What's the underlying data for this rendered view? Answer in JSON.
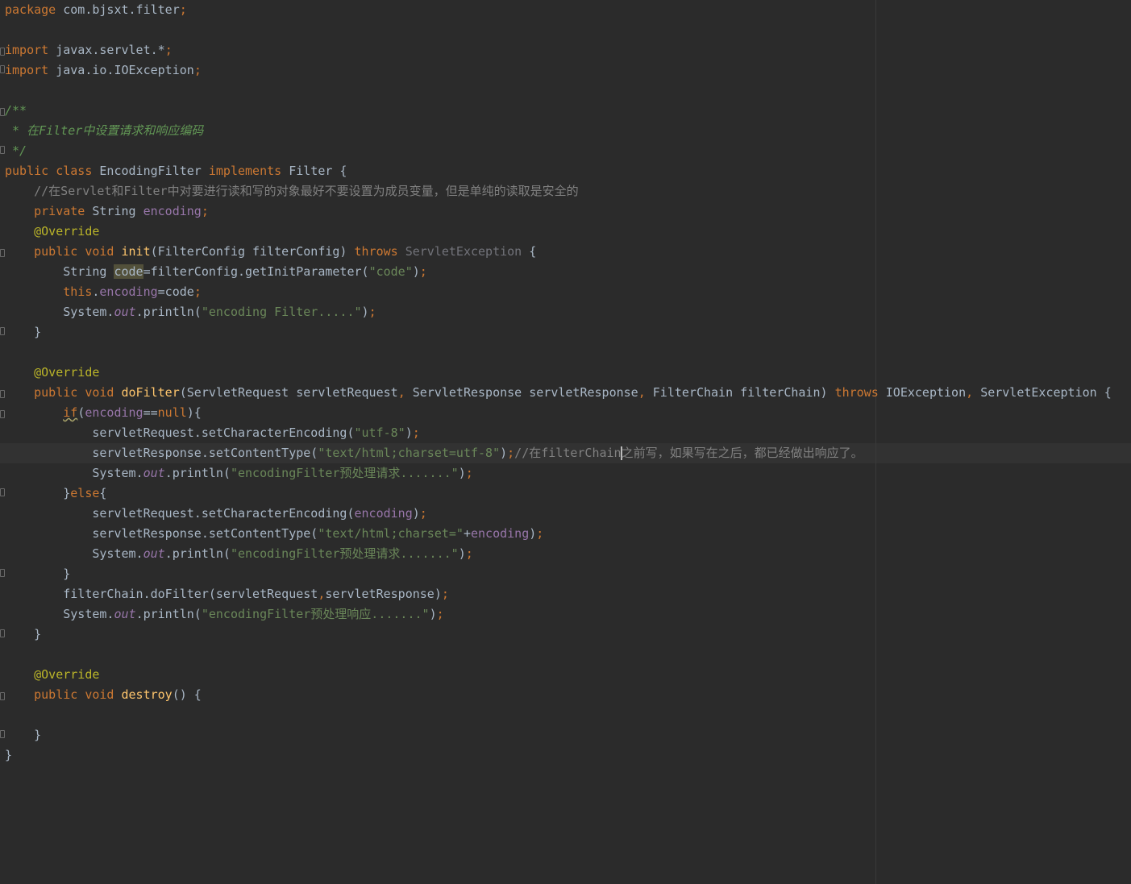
{
  "editor": {
    "language": "java",
    "current_line": 23,
    "highlighted_identifier": "code",
    "lines": [
      {
        "tokens": [
          {
            "t": "package ",
            "c": "kw"
          },
          {
            "t": "com.bjsxt.filter",
            "c": "plain"
          },
          {
            "t": ";",
            "c": "kw"
          }
        ]
      },
      {
        "tokens": []
      },
      {
        "fold": "start",
        "tokens": [
          {
            "t": "import ",
            "c": "kw"
          },
          {
            "t": "javax.servlet.*",
            "c": "plain"
          },
          {
            "t": ";",
            "c": "kw"
          }
        ]
      },
      {
        "fold": "end",
        "tokens": [
          {
            "t": "import ",
            "c": "kw"
          },
          {
            "t": "java.io.IOException",
            "c": "plain"
          },
          {
            "t": ";",
            "c": "kw"
          }
        ]
      },
      {
        "tokens": []
      },
      {
        "fold": "start",
        "tokens": [
          {
            "t": "/**",
            "c": "doc"
          }
        ]
      },
      {
        "tokens": [
          {
            "t": " * 在Filter中设置请求和响应编码",
            "c": "doc"
          }
        ]
      },
      {
        "fold": "end",
        "tokens": [
          {
            "t": " */",
            "c": "doc"
          }
        ]
      },
      {
        "tokens": [
          {
            "t": "public class ",
            "c": "kw"
          },
          {
            "t": "EncodingFilter ",
            "c": "plain"
          },
          {
            "t": "implements ",
            "c": "kw"
          },
          {
            "t": "Filter {",
            "c": "plain"
          }
        ]
      },
      {
        "tokens": [
          {
            "t": "    //在Servlet和Filter中对要进行读和写的对象最好不要设置为成员变量，但是单纯的读取是安全的",
            "c": "cmt"
          }
        ]
      },
      {
        "tokens": [
          {
            "t": "    private ",
            "c": "kw"
          },
          {
            "t": "String ",
            "c": "plain"
          },
          {
            "t": "encoding",
            "c": "field"
          },
          {
            "t": ";",
            "c": "kw"
          }
        ]
      },
      {
        "tokens": [
          {
            "t": "    @Override",
            "c": "ann"
          }
        ]
      },
      {
        "fold": "start",
        "tokens": [
          {
            "t": "    public void ",
            "c": "kw"
          },
          {
            "t": "init",
            "c": "method"
          },
          {
            "t": "(FilterConfig filterConfig) ",
            "c": "plain"
          },
          {
            "t": "throws ",
            "c": "kw"
          },
          {
            "t": "ServletException",
            "c": "unused"
          },
          {
            "t": " {",
            "c": "plain"
          }
        ]
      },
      {
        "tokens": [
          {
            "t": "        String ",
            "c": "plain"
          },
          {
            "t": "code",
            "c": "hl"
          },
          {
            "t": "=filterConfig.getInitParameter(",
            "c": "plain"
          },
          {
            "t": "\"code\"",
            "c": "str"
          },
          {
            "t": ")",
            "c": "plain"
          },
          {
            "t": ";",
            "c": "kw"
          }
        ]
      },
      {
        "tokens": [
          {
            "t": "        this",
            "c": "kw"
          },
          {
            "t": ".",
            "c": "plain"
          },
          {
            "t": "encoding",
            "c": "field"
          },
          {
            "t": "=code",
            "c": "plain"
          },
          {
            "t": ";",
            "c": "kw"
          }
        ]
      },
      {
        "tokens": [
          {
            "t": "        System.",
            "c": "plain"
          },
          {
            "t": "out",
            "c": "static"
          },
          {
            "t": ".println(",
            "c": "plain"
          },
          {
            "t": "\"encoding Filter.....\"",
            "c": "str"
          },
          {
            "t": ")",
            "c": "plain"
          },
          {
            "t": ";",
            "c": "kw"
          }
        ]
      },
      {
        "fold": "end",
        "tokens": [
          {
            "t": "    }",
            "c": "plain"
          }
        ]
      },
      {
        "tokens": []
      },
      {
        "tokens": [
          {
            "t": "    @Override",
            "c": "ann"
          }
        ]
      },
      {
        "fold": "start",
        "tokens": [
          {
            "t": "    public void ",
            "c": "kw"
          },
          {
            "t": "doFilter",
            "c": "method"
          },
          {
            "t": "(ServletRequest servletRequest",
            "c": "plain"
          },
          {
            "t": ", ",
            "c": "kw"
          },
          {
            "t": "ServletResponse servletResponse",
            "c": "plain"
          },
          {
            "t": ", ",
            "c": "kw"
          },
          {
            "t": "FilterChain filterChain) ",
            "c": "plain"
          },
          {
            "t": "throws ",
            "c": "kw"
          },
          {
            "t": "IOException",
            "c": "plain"
          },
          {
            "t": ", ",
            "c": "kw"
          },
          {
            "t": "ServletException {",
            "c": "plain"
          }
        ]
      },
      {
        "fold": "start",
        "tokens": [
          {
            "t": "        ",
            "c": "plain"
          },
          {
            "t": "if",
            "c": "kw warn"
          },
          {
            "t": "(",
            "c": "plain"
          },
          {
            "t": "encoding",
            "c": "field"
          },
          {
            "t": "==",
            "c": "plain"
          },
          {
            "t": "null",
            "c": "kw"
          },
          {
            "t": "){",
            "c": "plain"
          }
        ]
      },
      {
        "tokens": [
          {
            "t": "            servletRequest.setCharacterEncoding(",
            "c": "plain"
          },
          {
            "t": "\"utf-8\"",
            "c": "str"
          },
          {
            "t": ")",
            "c": "plain"
          },
          {
            "t": ";",
            "c": "kw"
          }
        ]
      },
      {
        "current": true,
        "tokens": [
          {
            "t": "            servletResponse.setContentType(",
            "c": "plain"
          },
          {
            "t": "\"text/html;charset=utf-8\"",
            "c": "str"
          },
          {
            "t": ")",
            "c": "plain"
          },
          {
            "t": ";",
            "c": "kw"
          },
          {
            "t": "//在filterChain",
            "c": "cmt"
          },
          {
            "t": "",
            "c": "caret"
          },
          {
            "t": "之前写，如果写在之后，都已经做出响应了。",
            "c": "cmt"
          }
        ]
      },
      {
        "tokens": [
          {
            "t": "            System.",
            "c": "plain"
          },
          {
            "t": "out",
            "c": "static"
          },
          {
            "t": ".println(",
            "c": "plain"
          },
          {
            "t": "\"encodingFilter预处理请求.......\"",
            "c": "str"
          },
          {
            "t": ")",
            "c": "plain"
          },
          {
            "t": ";",
            "c": "kw"
          }
        ]
      },
      {
        "fold": "end",
        "tokens": [
          {
            "t": "        }",
            "c": "plain"
          },
          {
            "t": "else",
            "c": "kw"
          },
          {
            "t": "{",
            "c": "plain"
          }
        ]
      },
      {
        "tokens": [
          {
            "t": "            servletRequest.setCharacterEncoding(",
            "c": "plain"
          },
          {
            "t": "encoding",
            "c": "field"
          },
          {
            "t": ")",
            "c": "plain"
          },
          {
            "t": ";",
            "c": "kw"
          }
        ]
      },
      {
        "tokens": [
          {
            "t": "            servletResponse.setContentType(",
            "c": "plain"
          },
          {
            "t": "\"text/html;charset=\"",
            "c": "str"
          },
          {
            "t": "+",
            "c": "plain"
          },
          {
            "t": "encoding",
            "c": "field"
          },
          {
            "t": ")",
            "c": "plain"
          },
          {
            "t": ";",
            "c": "kw"
          }
        ]
      },
      {
        "tokens": [
          {
            "t": "            System.",
            "c": "plain"
          },
          {
            "t": "out",
            "c": "static"
          },
          {
            "t": ".println(",
            "c": "plain"
          },
          {
            "t": "\"encodingFilter预处理请求.......\"",
            "c": "str"
          },
          {
            "t": ")",
            "c": "plain"
          },
          {
            "t": ";",
            "c": "kw"
          }
        ]
      },
      {
        "fold": "end",
        "tokens": [
          {
            "t": "        }",
            "c": "plain"
          }
        ]
      },
      {
        "tokens": [
          {
            "t": "        filterChain.doFilter(servletRequest",
            "c": "plain"
          },
          {
            "t": ",",
            "c": "kw"
          },
          {
            "t": "servletResponse)",
            "c": "plain"
          },
          {
            "t": ";",
            "c": "kw"
          }
        ]
      },
      {
        "tokens": [
          {
            "t": "        System.",
            "c": "plain"
          },
          {
            "t": "out",
            "c": "static"
          },
          {
            "t": ".println(",
            "c": "plain"
          },
          {
            "t": "\"encodingFilter预处理响应.......\"",
            "c": "str"
          },
          {
            "t": ")",
            "c": "plain"
          },
          {
            "t": ";",
            "c": "kw"
          }
        ]
      },
      {
        "fold": "end",
        "tokens": [
          {
            "t": "    }",
            "c": "plain"
          }
        ]
      },
      {
        "tokens": []
      },
      {
        "tokens": [
          {
            "t": "    @Override",
            "c": "ann"
          }
        ]
      },
      {
        "fold": "start",
        "tokens": [
          {
            "t": "    public void ",
            "c": "kw"
          },
          {
            "t": "destroy",
            "c": "method"
          },
          {
            "t": "() {",
            "c": "plain"
          }
        ]
      },
      {
        "tokens": []
      },
      {
        "fold": "end",
        "tokens": [
          {
            "t": "    }",
            "c": "plain"
          }
        ]
      },
      {
        "tokens": [
          {
            "t": "}",
            "c": "plain"
          }
        ]
      }
    ]
  },
  "colors": {
    "background": "#2b2b2b",
    "current_line": "#323232",
    "keyword": "#cc7832",
    "string": "#6a8759",
    "field": "#9876aa",
    "annotation": "#bbb529",
    "method_declaration": "#ffc66d",
    "comment": "#808080",
    "doc_comment": "#629755",
    "default_text": "#a9b7c6"
  }
}
